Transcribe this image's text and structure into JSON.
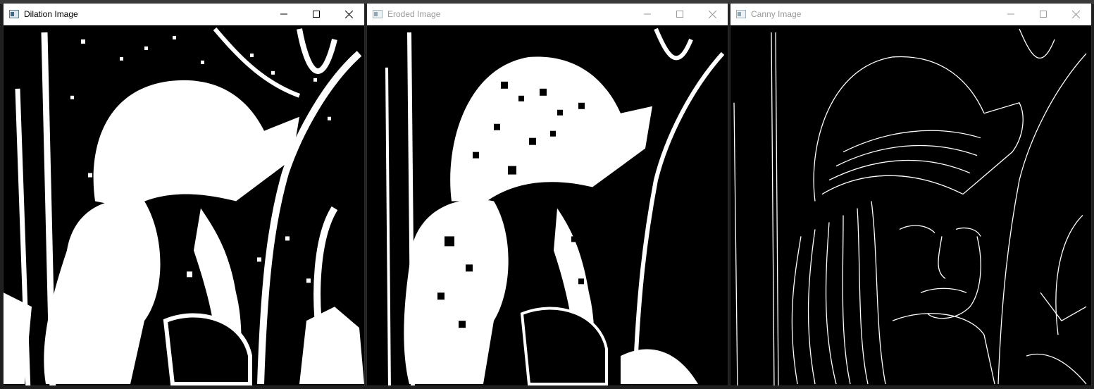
{
  "windows": [
    {
      "title": "Dilation Image",
      "active": true,
      "controls": {
        "minimize": "minimize-icon",
        "maximize": "maximize-icon",
        "close": "close-icon"
      }
    },
    {
      "title": "Eroded Image",
      "active": false,
      "controls": {
        "minimize": "minimize-icon",
        "maximize": "maximize-icon",
        "close": "close-icon"
      }
    },
    {
      "title": "Canny Image",
      "active": false,
      "controls": {
        "minimize": "minimize-icon",
        "maximize": "maximize-icon",
        "close": "close-icon"
      }
    }
  ],
  "colors": {
    "image_background": "#000000",
    "image_foreground": "#ffffff",
    "titlebar_active_text": "#000000",
    "titlebar_inactive_text": "#999999"
  }
}
